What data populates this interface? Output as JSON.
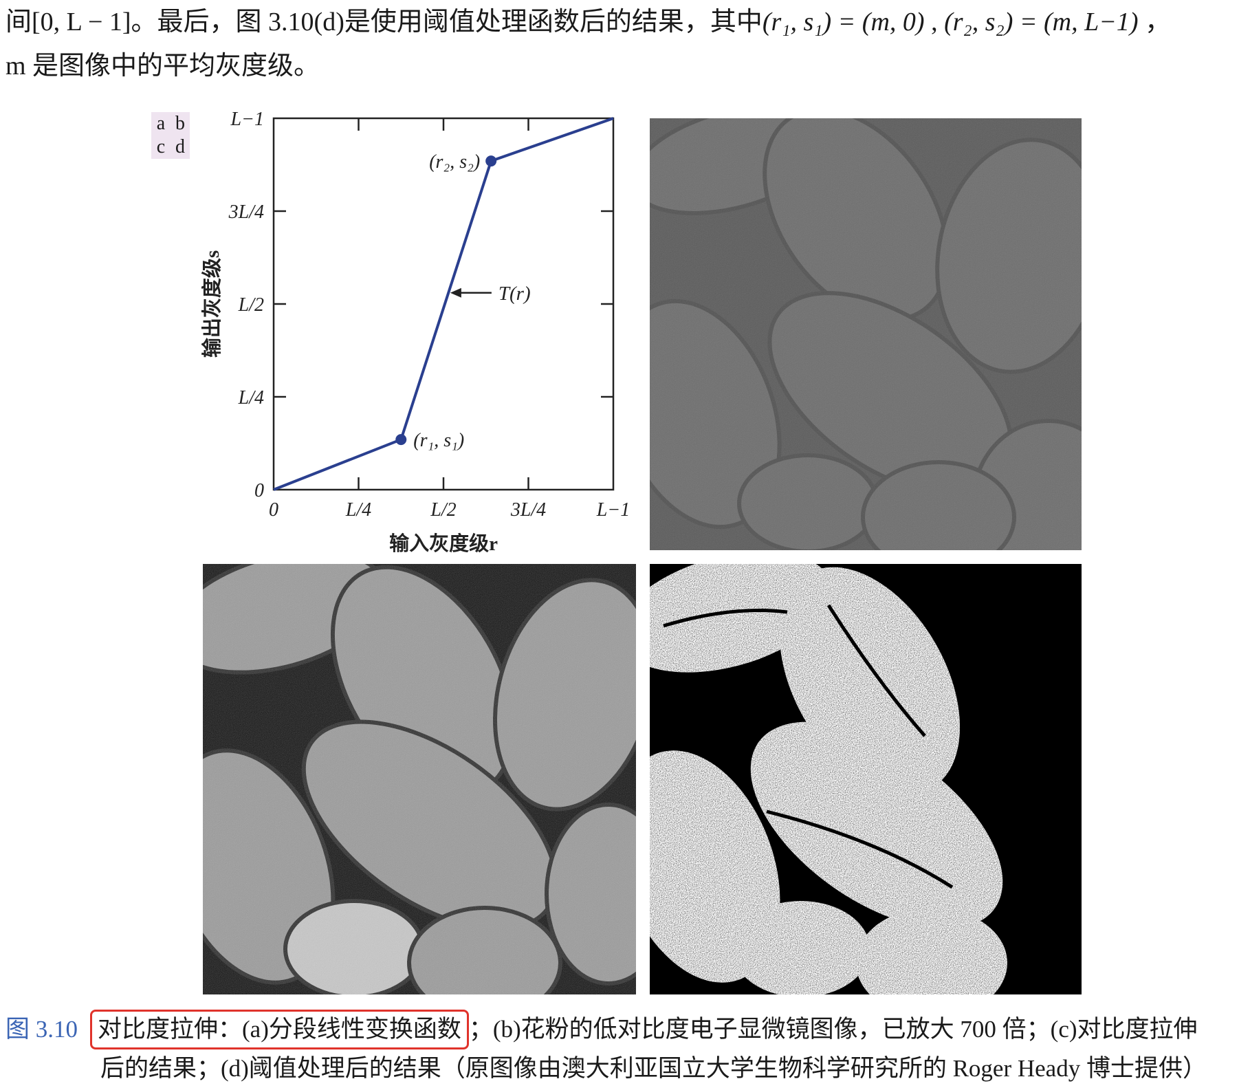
{
  "intro": {
    "line1_before": "间[0, L − 1]。最后，图 3.10(d)是使用阈值处理函数后的结果，其中",
    "pair1": "(r₁, s₁) = (m, 0)",
    "sep": " , ",
    "pair2": "(r₂, s₂) = (m, L−1)",
    "line1_end": " ，",
    "line2": "m 是图像中的平均灰度级。"
  },
  "panel_labels": [
    "a",
    "b",
    "c",
    "d"
  ],
  "chart_data": {
    "type": "line",
    "xlabel": "输入灰度级r",
    "ylabel": "输出灰度级s",
    "x_ticks": [
      "0",
      "L/4",
      "L/2",
      "3L/4",
      "L−1"
    ],
    "y_ticks": [
      "0",
      "L/4",
      "L/2",
      "3L/4",
      "L−1"
    ],
    "xlim": [
      0,
      1
    ],
    "ylim": [
      0,
      1
    ],
    "series": [
      {
        "name": "T(r)",
        "x": [
          0,
          0.375,
          0.64,
          1.0
        ],
        "y": [
          0,
          0.135,
          0.885,
          1.0
        ]
      }
    ],
    "points": [
      {
        "label": "(r₁, s₁)",
        "x": 0.375,
        "y": 0.135
      },
      {
        "label": "(r₂, s₂)",
        "x": 0.64,
        "y": 0.885
      }
    ],
    "annotation": {
      "text": "T(r)",
      "x": 0.52,
      "y": 0.53
    }
  },
  "colors": {
    "curve": "#2a3f8f",
    "caption_number": "#3a64b4",
    "highlight_box": "#e0332b"
  },
  "caption": {
    "number": "图 3.10",
    "highlighted": "对比度拉伸：(a)分段线性变换函数",
    "rest_line1": "；(b)花粉的低对比度电子显微镜图像，已放大 700 倍；(c)对比度拉伸",
    "line2": "后的结果；(d)阈值处理后的结果（原图像由澳大利亚国立大学生物科学研究所的 Roger Heady 博士提供）"
  }
}
